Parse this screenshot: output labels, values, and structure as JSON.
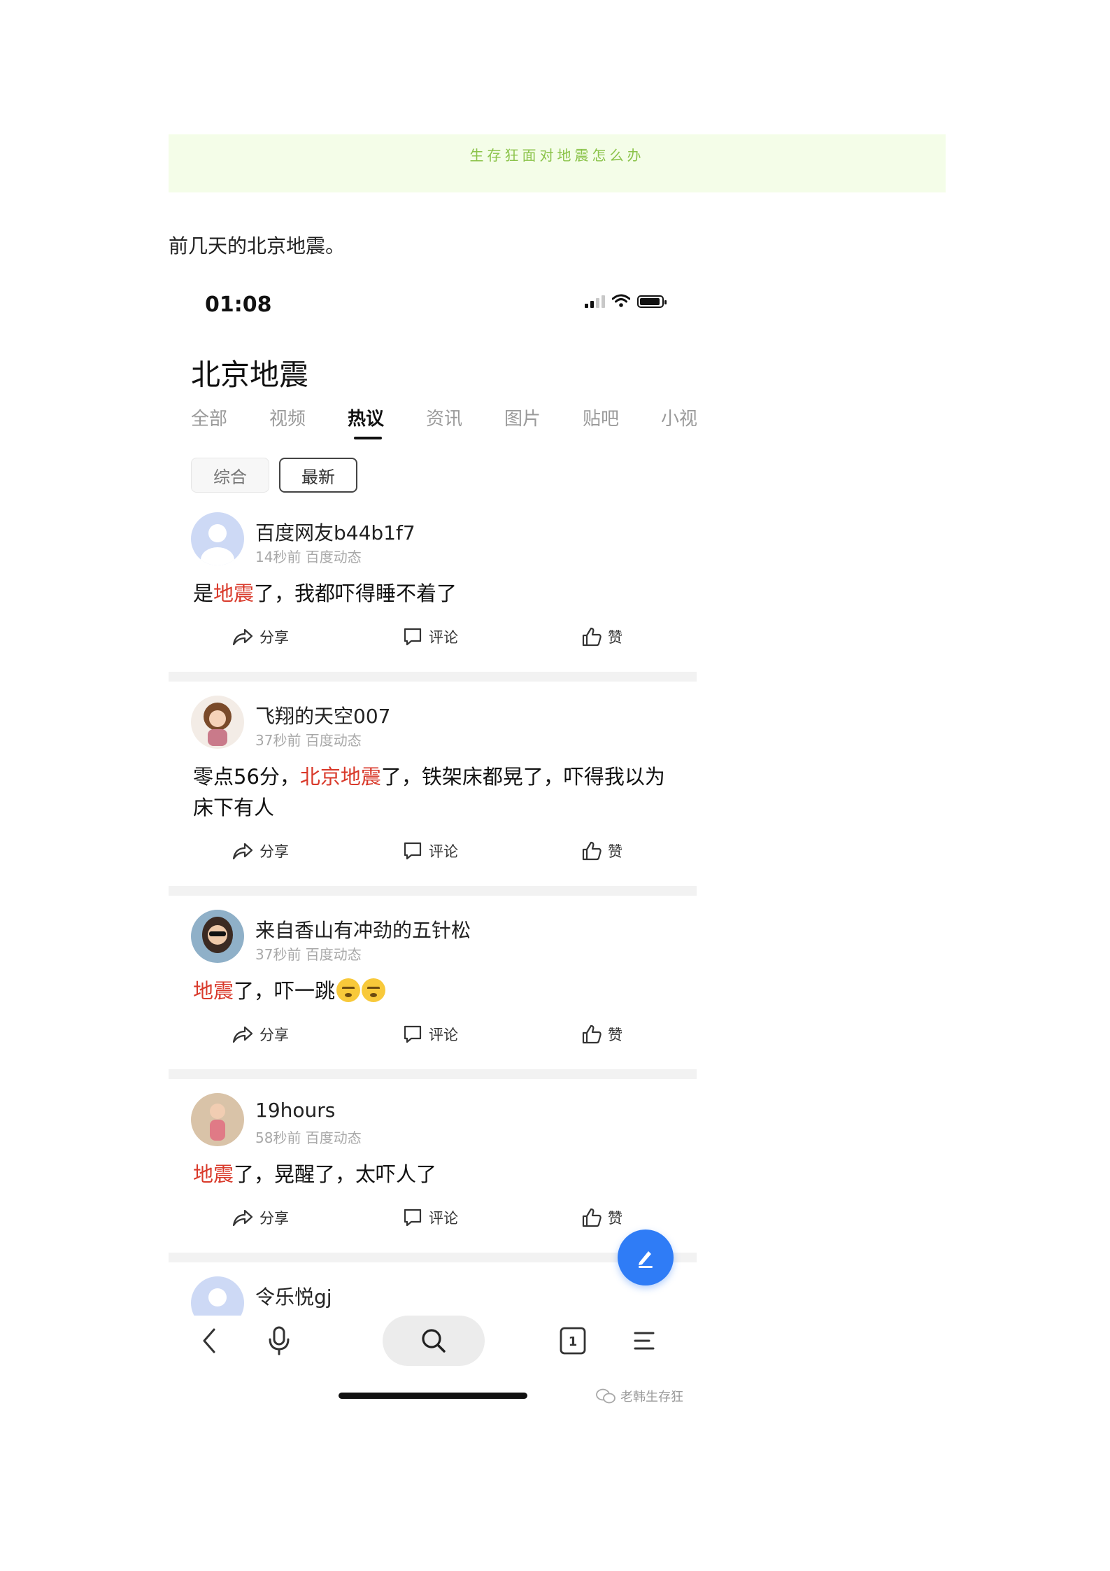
{
  "banner": {
    "text": "生存狂面对地震怎么办"
  },
  "intro_text": "前几天的北京地震。",
  "phone": {
    "status": {
      "time": "01:08"
    },
    "page_title": "北京地震",
    "tabs": [
      {
        "label": "全部"
      },
      {
        "label": "视频"
      },
      {
        "label": "热议"
      },
      {
        "label": "资讯"
      },
      {
        "label": "图片"
      },
      {
        "label": "贴吧"
      },
      {
        "label": "小视"
      }
    ],
    "active_tab": "热议",
    "filters": [
      {
        "label": "综合"
      },
      {
        "label": "最新"
      }
    ],
    "actions": {
      "share": "分享",
      "comment": "评论",
      "like": "赞"
    },
    "posts": [
      {
        "user": "百度网友b44b1f7",
        "meta": "14秒前 百度动态",
        "content": {
          "before": "是",
          "highlight": "地震",
          "after": "了，我都吓得睡不着了"
        }
      },
      {
        "user": "飞翔的天空007",
        "meta": "37秒前 百度动态",
        "content": {
          "before": "零点56分，",
          "highlight": "北京地震",
          "after": "了，铁架床都晃了，吓得我以为床下有人"
        }
      },
      {
        "user": "来自香山有冲劲的五针松",
        "meta": "37秒前 百度动态",
        "content": {
          "before": "",
          "highlight": "地震",
          "after": "了，吓一跳"
        }
      },
      {
        "user": "19hours",
        "meta": "58秒前 百度动态",
        "content": {
          "before": "",
          "highlight": "地震",
          "after": "了，晃醒了，太吓人了"
        }
      },
      {
        "user": "令乐悦gj"
      }
    ],
    "tab_count": "1",
    "watermark": "老韩生存狂"
  },
  "colors": {
    "highlight": "#d93a2b",
    "fab": "#2f7cf6",
    "banner_bg": "#f4fde8",
    "banner_text": "#8bc34a"
  },
  "icons": [
    "signal-icon",
    "wifi-icon",
    "battery-icon",
    "share-icon",
    "comment-icon",
    "like-icon",
    "edit-icon",
    "back-icon",
    "microphone-icon",
    "search-icon",
    "tabs-icon",
    "menu-icon",
    "wechat-icon"
  ]
}
